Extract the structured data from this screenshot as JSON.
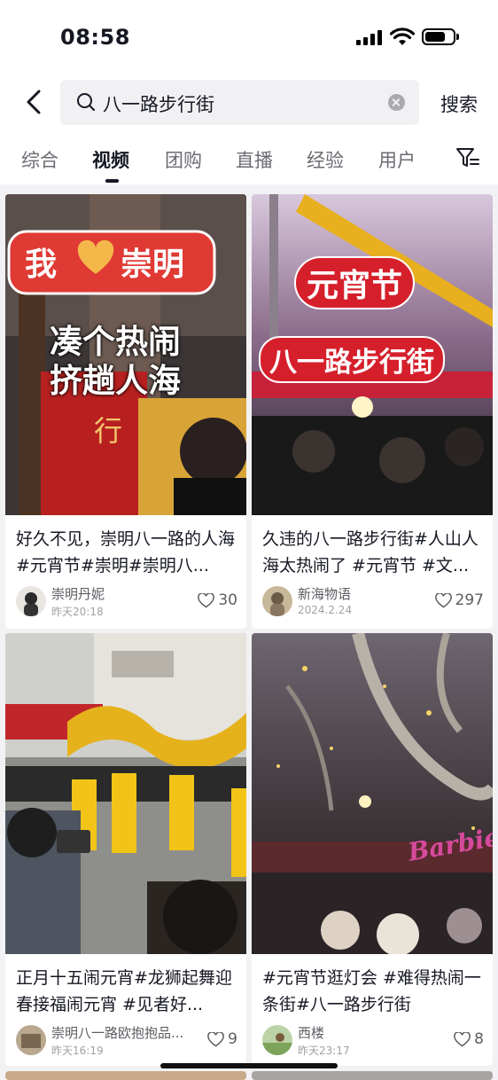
{
  "status": {
    "time": "08:58"
  },
  "search": {
    "query": "八一路步行街",
    "button": "搜索"
  },
  "tabs": [
    "综合",
    "视频",
    "团购",
    "直播",
    "经验",
    "用户"
  ],
  "active_tab": "视频",
  "cards": [
    {
      "thumb_text": [
        "我",
        "崇明",
        "凑个热闹",
        "挤趟人海",
        "行"
      ],
      "caption": "好久不见，崇明八一路的人海#元宵节#崇明#崇明八...",
      "author": "崇明丹妮",
      "date": "昨天20:18",
      "likes": "30"
    },
    {
      "thumb_text": [
        "元宵节",
        "八一路步行街"
      ],
      "caption": "久违的八一路步行街#人山人海太热闹了 #元宵节 #文...",
      "author": "新海物语",
      "date": "2024.2.24",
      "likes": "297"
    },
    {
      "thumb_text": [],
      "caption": "正月十五闹元宵#龙狮起舞迎春接福闹元宵 #见者好...",
      "author": "崇明八一路欧抱抱品...",
      "date": "昨天16:19",
      "likes": "9"
    },
    {
      "thumb_text": [
        "Barbie"
      ],
      "caption": "#元宵节逛灯会 #难得热闹一条街#八一路步行街",
      "author": "西楼",
      "date": "昨天23:17",
      "likes": "8"
    }
  ],
  "colors": {
    "accent_red": "#d82b2b",
    "text": "#161823",
    "secondary": "#5c5d63"
  }
}
